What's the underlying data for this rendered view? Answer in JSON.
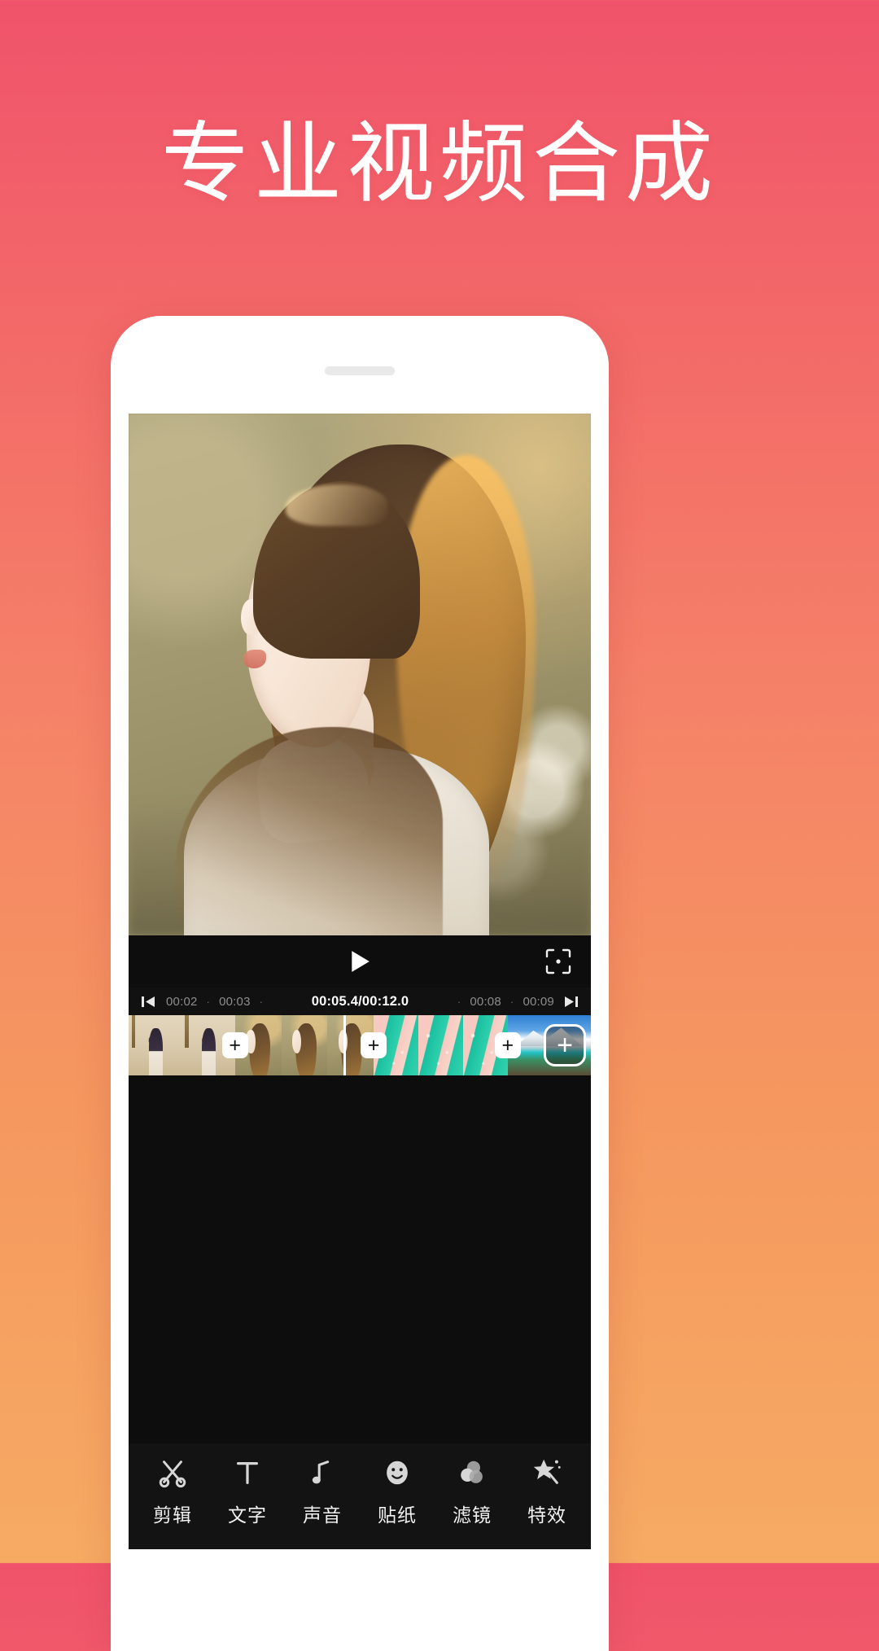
{
  "headline": "专业视频合成",
  "theme": {
    "gradient_top": "#F0536B",
    "gradient_bottom": "#F6AB63",
    "phone_body": "#FFFFFF",
    "screen_bg": "#0D0D0D",
    "accent_white": "#FFFFFF"
  },
  "phone": {
    "speaker_notch": "speaker-notch"
  },
  "player": {
    "play_icon": "play-icon",
    "fullscreen_icon": "fullscreen-crop-icon",
    "preview_alt": "video-preview-frame"
  },
  "timeline": {
    "prev_frame_icon": "previous-frame-icon",
    "next_frame_icon": "next-frame-icon",
    "ticks_left": [
      "00:02",
      "00:03"
    ],
    "ticks_right": [
      "00:08",
      "00:09"
    ],
    "current_time": "00:05.4",
    "total_time": "00:12.0",
    "time_display": "00:05.4/00:12.0",
    "dot": "·"
  },
  "filmstrip": {
    "add_label": "+",
    "add_clip_label": "+",
    "clips": [
      {
        "name": "clip-1-indoor-portrait",
        "thumbs": 2
      },
      {
        "name": "clip-2-outdoor-portrait",
        "thumbs": 3
      },
      {
        "name": "clip-3-abstract-pattern",
        "thumbs": 3
      },
      {
        "name": "clip-4-mountain-lake",
        "thumbs": 1
      }
    ]
  },
  "toolbar": {
    "items": [
      {
        "label": "剪辑",
        "icon": "scissors-icon"
      },
      {
        "label": "文字",
        "icon": "text-t-icon"
      },
      {
        "label": "声音",
        "icon": "music-note-icon"
      },
      {
        "label": "贴纸",
        "icon": "smiley-sticker-icon"
      },
      {
        "label": "滤镜",
        "icon": "filter-circles-icon"
      },
      {
        "label": "特效",
        "icon": "magic-wand-star-icon"
      }
    ]
  }
}
